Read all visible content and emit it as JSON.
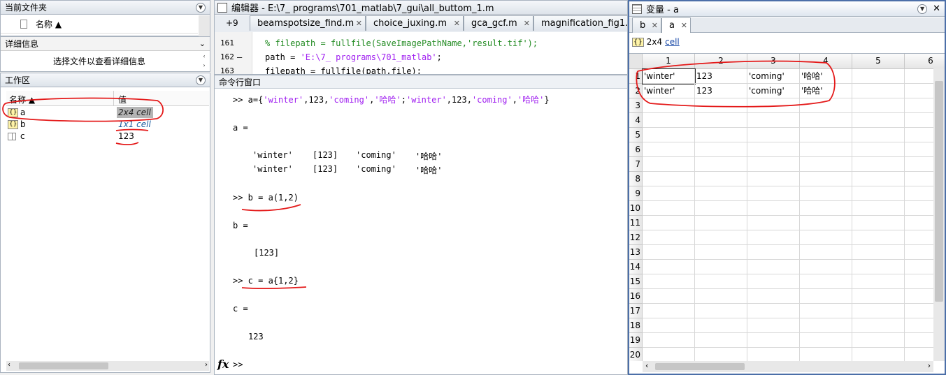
{
  "current_folder": {
    "title": "当前文件夹",
    "col_name": "名称 ▲"
  },
  "details": {
    "title": "详细信息",
    "hint": "选择文件以查看详细信息"
  },
  "workspace": {
    "title": "工作区",
    "col_name": "名称 ▲",
    "col_value": "值",
    "rows": [
      {
        "name": "a",
        "value": "2x4 cell",
        "icon": "cell-icon"
      },
      {
        "name": "b",
        "value": "1x1 cell",
        "icon": "cell-icon"
      },
      {
        "name": "c",
        "value": "123",
        "icon": "matrix-icon"
      }
    ]
  },
  "editor": {
    "title": "编辑器 - E:\\7_ programs\\701_matlab\\7_gui\\all_buttom_1.m",
    "overflow_badge": "+9",
    "tabs": [
      "beamspotsize_find.m",
      "choice_juxing.m",
      "gca_gcf.m",
      "magnification_fig1.m"
    ],
    "lines": [
      {
        "num": "161",
        "dash": "",
        "code": "% filepath = fullfile(SaveImagePathName,'result.tif');"
      },
      {
        "num": "162",
        "dash": "—",
        "code_pre": "path = ",
        "code_str": "'E:\\7_ programs\\701_matlab'",
        "code_post": ";"
      },
      {
        "num": "163",
        "dash": "",
        "code": "filepath = fullfile(path,file);"
      }
    ]
  },
  "command_window": {
    "title": "命令行窗口",
    "cmd1_pre": ">> a={",
    "cmd1_str1": "'winter'",
    "cmd1_mid1": ",123,",
    "cmd1_str2": "'coming'",
    "cmd1_mid2": ",",
    "cmd1_str3": "'哈哈'",
    "cmd1_mid3": ";",
    "cmd1_str4": "'winter'",
    "cmd1_mid4": ",123,",
    "cmd1_str5": "'coming'",
    "cmd1_mid5": ",",
    "cmd1_str6": "'哈哈'",
    "cmd1_post": "}",
    "out_a": "a =",
    "a_row1": [
      "'winter'",
      "[123]",
      "'coming'",
      "'哈哈'"
    ],
    "a_row2": [
      "'winter'",
      "[123]",
      "'coming'",
      "'哈哈'"
    ],
    "cmd2": ">> b = a(1,2)",
    "out_b": "b =",
    "b_val": "[123]",
    "cmd3": ">> c = a{1,2}",
    "out_c": "c =",
    "c_val": "123",
    "prompt": ">>",
    "fx": "fx"
  },
  "variables": {
    "title": "变量 - a",
    "tabs": [
      "b",
      "a"
    ],
    "info_size": "2x4",
    "info_class": "cell",
    "col_headers": [
      "1",
      "2",
      "3",
      "4",
      "5",
      "6"
    ],
    "row_headers": [
      "1",
      "2",
      "3",
      "4",
      "5",
      "6",
      "7",
      "8",
      "9",
      "10",
      "11",
      "12",
      "13",
      "14",
      "15",
      "16",
      "17",
      "18",
      "19",
      "20"
    ],
    "data": [
      [
        "'winter'",
        "123",
        "'coming'",
        "'哈哈'"
      ],
      [
        "'winter'",
        "123",
        "'coming'",
        "'哈哈'"
      ]
    ]
  },
  "colors": {
    "annotation_red": "#e41a1a",
    "string_purple": "#a020f0",
    "comment_green": "#228b22",
    "selected_value_bg": "#b4b4b4",
    "link_blue": "#1a4aa8"
  }
}
